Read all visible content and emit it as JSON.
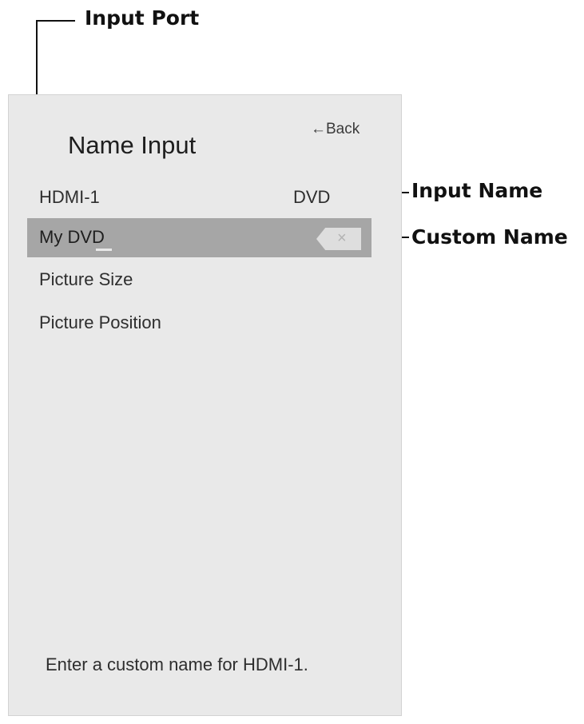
{
  "callouts": {
    "input_port": "Input Port",
    "input_name": "Input Name",
    "custom_name": "Custom Name"
  },
  "screen": {
    "title": "Name Input",
    "back_label": "←Back",
    "input_port": "HDMI-1",
    "input_name": "DVD",
    "custom_name_value": "My DVD",
    "clear_icon": "×",
    "menu_items": [
      "Picture Size",
      "Picture Position"
    ],
    "help_text": "Enter a custom name for HDMI-1."
  }
}
